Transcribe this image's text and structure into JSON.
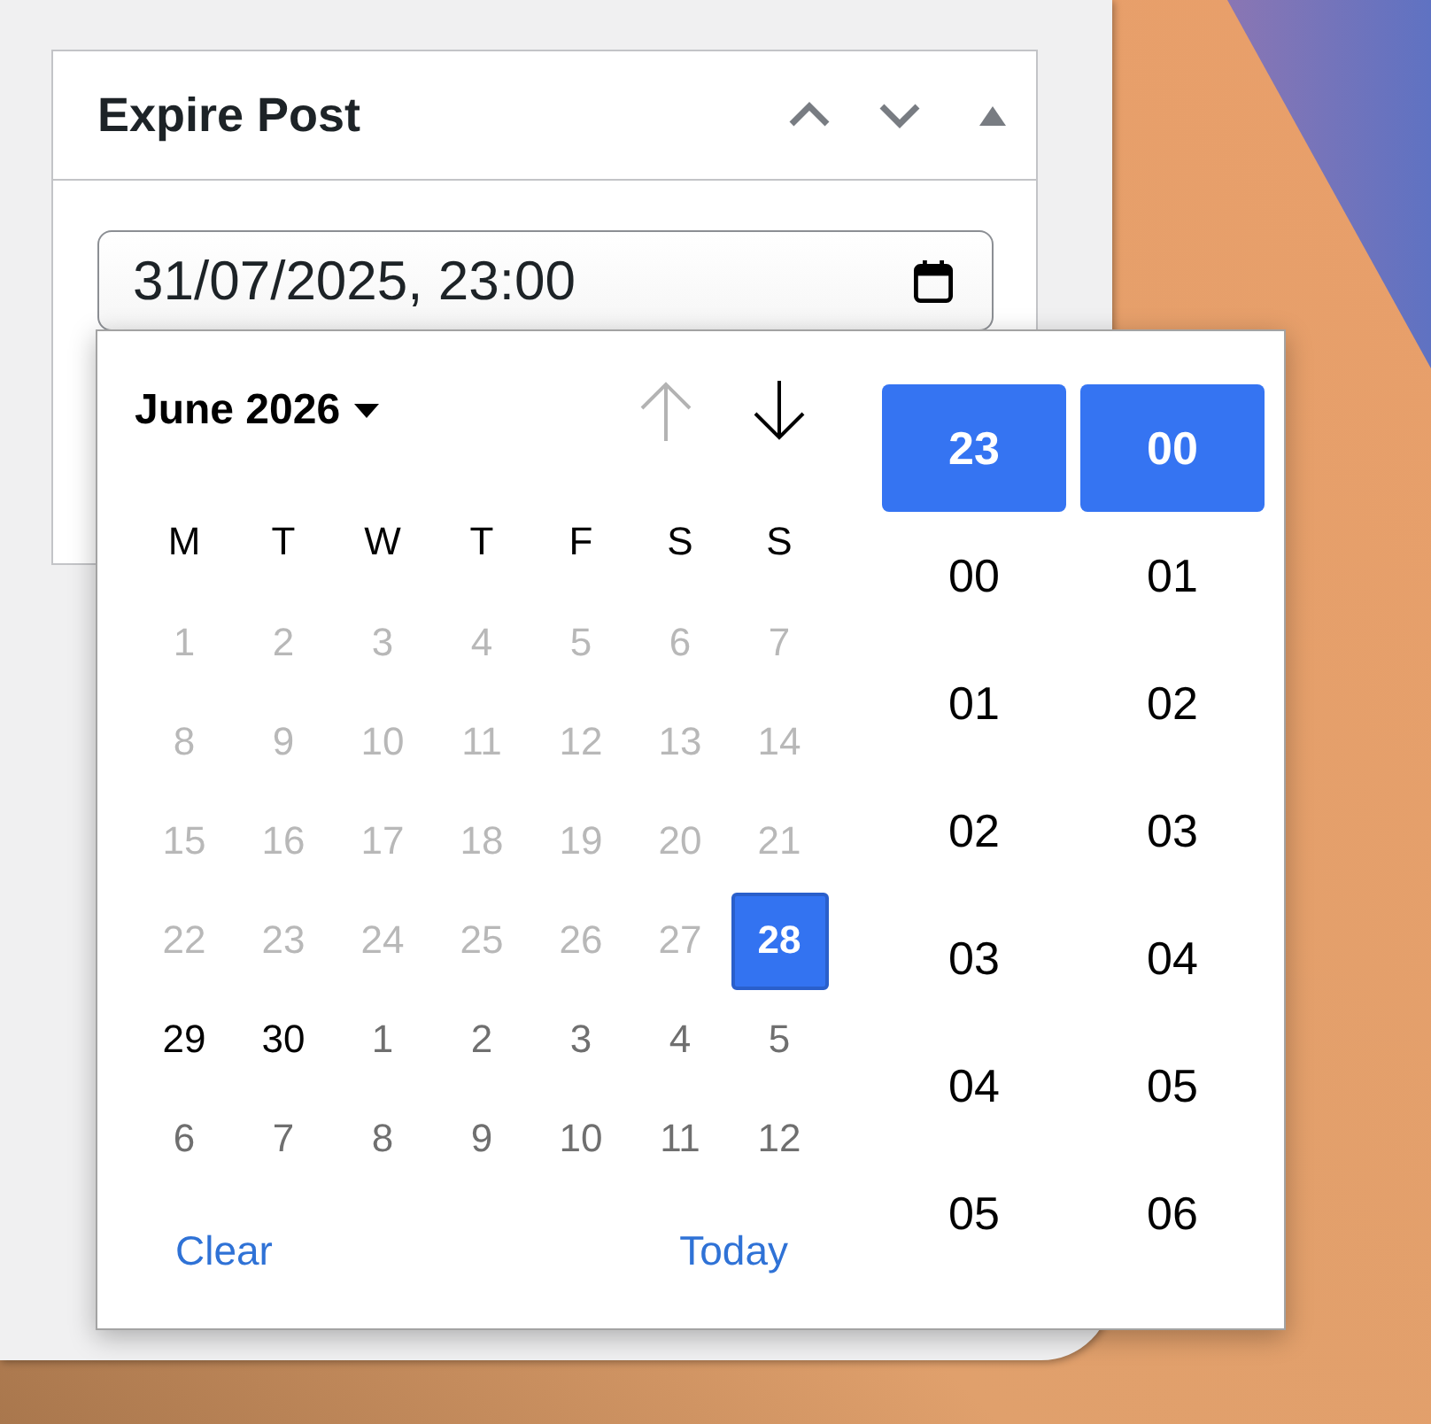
{
  "panel": {
    "title": "Expire Post"
  },
  "date_field": {
    "value": "31/07/2025, 23:00"
  },
  "picker": {
    "month_label": "June 2026",
    "nav_buttons": [
      {
        "kind": "previous",
        "disabled": true
      },
      {
        "kind": "next",
        "disabled": false
      }
    ],
    "weekdays": [
      "M",
      "T",
      "W",
      "T",
      "F",
      "S",
      "S"
    ],
    "days": [
      {
        "label": "1",
        "kind": "disabled",
        "selected": false
      },
      {
        "label": "2",
        "kind": "disabled",
        "selected": false
      },
      {
        "label": "3",
        "kind": "disabled",
        "selected": false
      },
      {
        "label": "4",
        "kind": "disabled",
        "selected": false
      },
      {
        "label": "5",
        "kind": "disabled",
        "selected": false
      },
      {
        "label": "6",
        "kind": "disabled",
        "selected": false
      },
      {
        "label": "7",
        "kind": "disabled",
        "selected": false
      },
      {
        "label": "8",
        "kind": "disabled",
        "selected": false
      },
      {
        "label": "9",
        "kind": "disabled",
        "selected": false
      },
      {
        "label": "10",
        "kind": "disabled",
        "selected": false
      },
      {
        "label": "11",
        "kind": "disabled",
        "selected": false
      },
      {
        "label": "12",
        "kind": "disabled",
        "selected": false
      },
      {
        "label": "13",
        "kind": "disabled",
        "selected": false
      },
      {
        "label": "14",
        "kind": "disabled",
        "selected": false
      },
      {
        "label": "15",
        "kind": "disabled",
        "selected": false
      },
      {
        "label": "16",
        "kind": "disabled",
        "selected": false
      },
      {
        "label": "17",
        "kind": "disabled",
        "selected": false
      },
      {
        "label": "18",
        "kind": "disabled",
        "selected": false
      },
      {
        "label": "19",
        "kind": "disabled",
        "selected": false
      },
      {
        "label": "20",
        "kind": "disabled",
        "selected": false
      },
      {
        "label": "21",
        "kind": "disabled",
        "selected": false
      },
      {
        "label": "22",
        "kind": "disabled",
        "selected": false
      },
      {
        "label": "23",
        "kind": "disabled",
        "selected": false
      },
      {
        "label": "24",
        "kind": "disabled",
        "selected": false
      },
      {
        "label": "25",
        "kind": "disabled",
        "selected": false
      },
      {
        "label": "26",
        "kind": "disabled",
        "selected": false
      },
      {
        "label": "27",
        "kind": "disabled",
        "selected": false
      },
      {
        "label": "28",
        "kind": "current",
        "selected": true
      },
      {
        "label": "29",
        "kind": "current",
        "selected": false
      },
      {
        "label": "30",
        "kind": "current",
        "selected": false
      },
      {
        "label": "1",
        "kind": "adjacent",
        "selected": false
      },
      {
        "label": "2",
        "kind": "adjacent",
        "selected": false
      },
      {
        "label": "3",
        "kind": "adjacent",
        "selected": false
      },
      {
        "label": "4",
        "kind": "adjacent",
        "selected": false
      },
      {
        "label": "5",
        "kind": "adjacent",
        "selected": false
      },
      {
        "label": "6",
        "kind": "adjacent",
        "selected": false
      },
      {
        "label": "7",
        "kind": "adjacent",
        "selected": false
      },
      {
        "label": "8",
        "kind": "adjacent",
        "selected": false
      },
      {
        "label": "9",
        "kind": "adjacent",
        "selected": false
      },
      {
        "label": "10",
        "kind": "adjacent",
        "selected": false
      },
      {
        "label": "11",
        "kind": "adjacent",
        "selected": false
      },
      {
        "label": "12",
        "kind": "adjacent",
        "selected": false
      }
    ],
    "actions": [
      "Clear",
      "Today"
    ],
    "hours": [
      {
        "label": "23",
        "selected": true
      },
      {
        "label": "00",
        "selected": false
      },
      {
        "label": "01",
        "selected": false
      },
      {
        "label": "02",
        "selected": false
      },
      {
        "label": "03",
        "selected": false
      },
      {
        "label": "04",
        "selected": false
      },
      {
        "label": "05",
        "selected": false
      }
    ],
    "minutes": [
      {
        "label": "00",
        "selected": true
      },
      {
        "label": "01",
        "selected": false
      },
      {
        "label": "02",
        "selected": false
      },
      {
        "label": "03",
        "selected": false
      },
      {
        "label": "04",
        "selected": false
      },
      {
        "label": "05",
        "selected": false
      },
      {
        "label": "06",
        "selected": false
      }
    ]
  }
}
